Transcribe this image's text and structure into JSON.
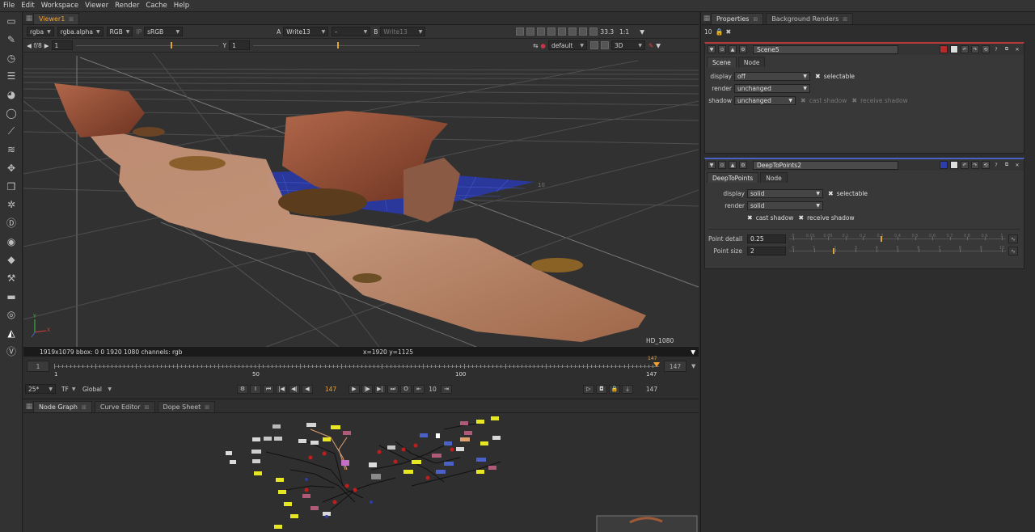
{
  "menu": [
    "File",
    "Edit",
    "Workspace",
    "Viewer",
    "Render",
    "Cache",
    "Help"
  ],
  "viewer": {
    "tab": "Viewer1",
    "channels": "rgba",
    "alpha": "rgba.alpha",
    "rgb": "RGB",
    "ip": "IP",
    "lut": "sRGB",
    "a_label": "A",
    "input_a": "Write13",
    "dash": "-",
    "b_label": "B",
    "input_b": "Write13",
    "zoom": "33.3",
    "ratio": "1:1",
    "fstop": "f/8",
    "gain": "1",
    "gamma_label": "Y",
    "gamma": "1",
    "camera": "default",
    "mode": "3D",
    "format_label": "HD_1080",
    "grid_label": "10",
    "status_left": "1919x1079  bbox: 0 0 1920 1080 channels: rgb",
    "status_coords": "x=1920 y=1125"
  },
  "timeline": {
    "start": "1",
    "end": "147",
    "ticks": [
      "1",
      "50",
      "100",
      "147"
    ],
    "current_marker": "147",
    "fps": "25*",
    "tf": "TF",
    "scope": "Global",
    "current_frame": "147",
    "step": "10",
    "out_frame": "147",
    "playhead": 1.0
  },
  "nodegraph": {
    "tabs": [
      "Node Graph",
      "Curve Editor",
      "Dope Sheet"
    ]
  },
  "properties": {
    "tabs": [
      "Properties",
      "Background Renders"
    ],
    "max_panels": "10",
    "scene": {
      "name": "Scene5",
      "tabs": [
        "Scene",
        "Node"
      ],
      "display_label": "display",
      "display": "off",
      "selectable": "selectable",
      "render_label": "render",
      "render": "unchanged",
      "shadow_label": "shadow",
      "shadow": "unchanged",
      "cast_shadow": "cast shadow",
      "receive_shadow": "receive shadow"
    },
    "deep": {
      "name": "DeepToPoints2",
      "tabs": [
        "DeepToPoints",
        "Node"
      ],
      "display_label": "display",
      "display": "solid",
      "selectable": "selectable",
      "render_label": "render",
      "render": "solid",
      "cast_shadow": "cast shadow",
      "receive_shadow": "receive shadow",
      "point_detail_label": "Point detail",
      "point_detail": "0.25",
      "point_detail_ticks": [
        "0",
        "0.01",
        "0.05",
        "0.1",
        "0.2",
        "0.3",
        "0.4",
        "0.5",
        "0.6",
        "0.7",
        "0.8",
        "0.9",
        "1"
      ],
      "point_size_label": "Point size",
      "point_size": "2",
      "point_size_ticks": [
        "0",
        "1",
        "2",
        "3",
        "4",
        "5",
        "6",
        "7",
        "8",
        "9",
        "10"
      ]
    }
  },
  "colors": {
    "accent": "#f2a234",
    "scene_bar": "#b83a3a",
    "deep_bar": "#4a62c7",
    "grid_plane": "#2a3aa8"
  }
}
